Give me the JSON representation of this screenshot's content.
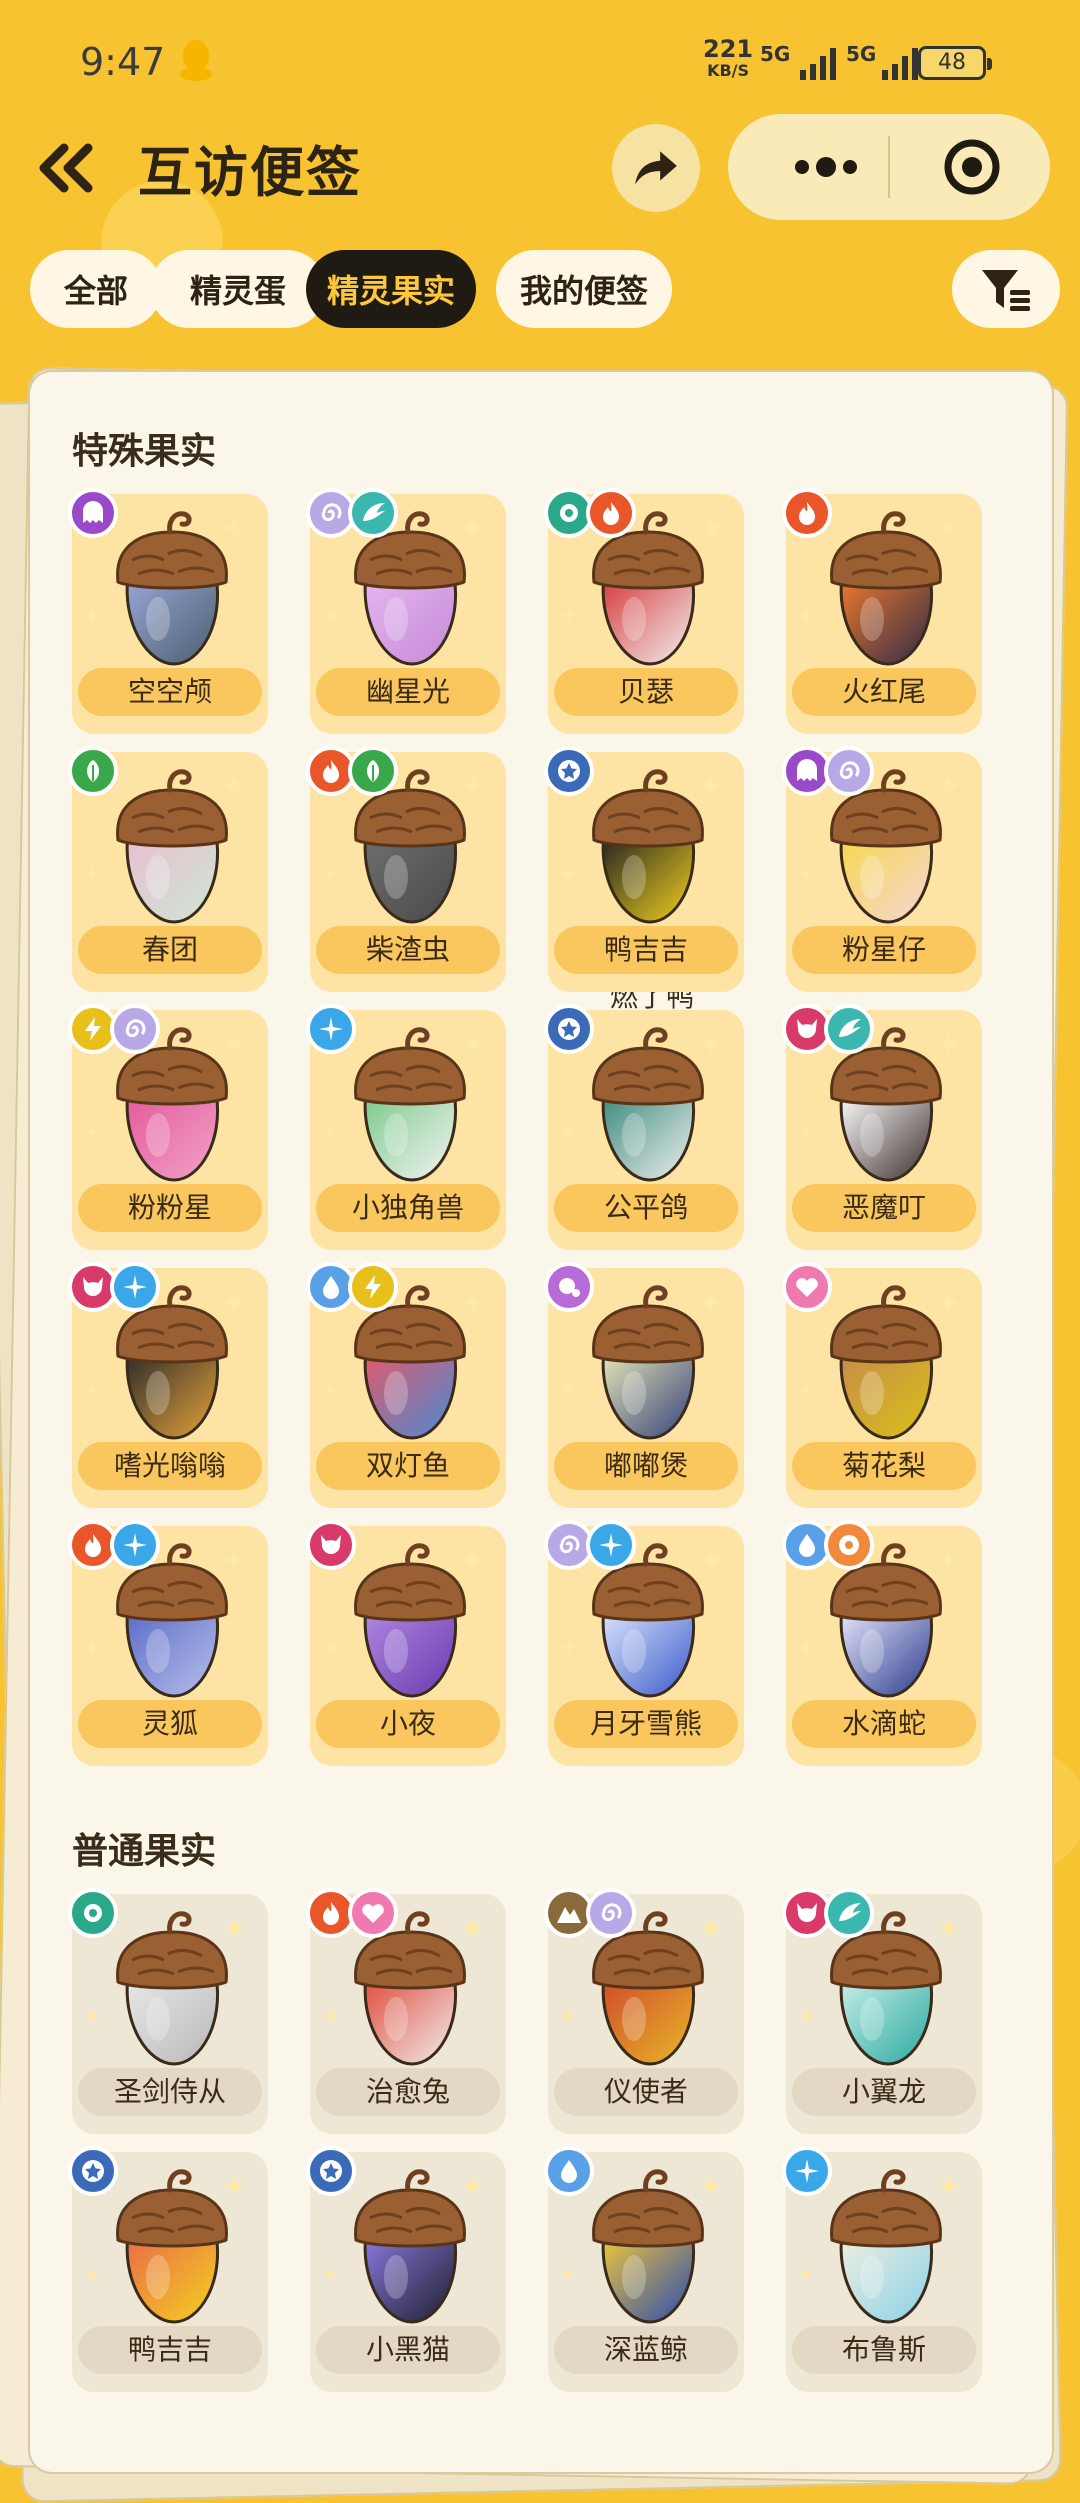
{
  "status_bar": {
    "time": "9:47",
    "net_speed": "221",
    "net_unit": "KB/S",
    "sig1": "5G",
    "sig2": "5G",
    "battery": "48"
  },
  "header": {
    "title": "互访便签"
  },
  "tabs": [
    {
      "label": "全部",
      "active": false
    },
    {
      "label": "精灵蛋",
      "active": false
    },
    {
      "label": "精灵果实",
      "active": true
    },
    {
      "label": "我的便签",
      "active": false
    }
  ],
  "sections": {
    "special": {
      "title": "特殊果实"
    },
    "normal": {
      "title": "普通果实"
    }
  },
  "special_items": [
    {
      "name": "空空颅",
      "badges": [
        "ghost-icon"
      ],
      "colors": [
        "#4a5f6e",
        "#9aa6d8"
      ]
    },
    {
      "name": "幽星光",
      "badges": [
        "spiral-icon",
        "wing-icon"
      ],
      "colors": [
        "#c48ad6",
        "#e6b6f0"
      ]
    },
    {
      "name": "贝瑟",
      "badges": [
        "gear-icon",
        "fire-icon"
      ],
      "colors": [
        "#f2f2f2",
        "#d63a3a"
      ]
    },
    {
      "name": "火红尾",
      "badges": [
        "fire-icon"
      ],
      "colors": [
        "#2e2a4a",
        "#f07a2a"
      ]
    },
    {
      "name": "春团",
      "badges": [
        "leaf-icon"
      ],
      "colors": [
        "#cfe6d4",
        "#e8bfd0"
      ]
    },
    {
      "name": "柴渣虫",
      "badges": [
        "fire-icon",
        "leaf-icon"
      ],
      "colors": [
        "#4a4a4a",
        "#6e6e6e"
      ]
    },
    {
      "name": "鸭吉吉",
      "badges": [
        "star-icon"
      ],
      "colors": [
        "#f5d21e",
        "#222222"
      ]
    },
    {
      "name": "粉星仔",
      "badges": [
        "ghost-icon",
        "spiral-icon"
      ],
      "colors": [
        "#f6d6d6",
        "#f5d84a"
      ]
    },
    {
      "name": "粉粉星",
      "badges": [
        "bolt-icon",
        "spiral-icon"
      ],
      "colors": [
        "#f2a2c8",
        "#e35a9a"
      ]
    },
    {
      "name": "小独角兽",
      "badges": [
        "sparkle-icon"
      ],
      "colors": [
        "#f4f4f4",
        "#7ac88a"
      ]
    },
    {
      "name": "公平鸽",
      "badges": [
        "star-icon"
      ],
      "colors": [
        "#f0f0f0",
        "#3a8a7a"
      ]
    },
    {
      "name": "恶魔叮",
      "badges": [
        "demon-icon",
        "wing-icon"
      ],
      "colors": [
        "#3a2e2a",
        "#ffffff"
      ]
    },
    {
      "name": "嗜光嗡嗡",
      "badges": [
        "demon-icon",
        "sparkle-icon"
      ],
      "colors": [
        "#e8a33a",
        "#2a2a2a"
      ]
    },
    {
      "name": "双灯鱼",
      "badges": [
        "water-icon",
        "bolt-icon"
      ],
      "colors": [
        "#4a8ad6",
        "#e35a6a"
      ]
    },
    {
      "name": "嘟嘟煲",
      "badges": [
        "bubble-icon"
      ],
      "colors": [
        "#34407a",
        "#e8e8b8"
      ]
    },
    {
      "name": "菊花梨",
      "badges": [
        "heart-icon"
      ],
      "colors": [
        "#d8c21a",
        "#c88a4a"
      ]
    },
    {
      "name": "灵狐",
      "badges": [
        "fire-icon",
        "sparkle-icon"
      ],
      "colors": [
        "#b8c0ea",
        "#5a6ac8"
      ]
    },
    {
      "name": "小夜",
      "badges": [
        "demon-icon"
      ],
      "colors": [
        "#6a3ab0",
        "#b088e0"
      ]
    },
    {
      "name": "月牙雪熊",
      "badges": [
        "spiral-icon",
        "sparkle-icon"
      ],
      "colors": [
        "#3a5ac8",
        "#dce6ff"
      ]
    },
    {
      "name": "水滴蛇",
      "badges": [
        "water-icon",
        "flower-icon"
      ],
      "colors": [
        "#2a3a8a",
        "#e8e8ff"
      ]
    }
  ],
  "nickname_note": "燃了鸭",
  "normal_items": [
    {
      "name": "圣剑侍从",
      "badges": [
        "gear-icon"
      ],
      "colors": [
        "#b8b8b8",
        "#e8e8e8"
      ]
    },
    {
      "name": "治愈兔",
      "badges": [
        "fire-icon",
        "heart-icon"
      ],
      "colors": [
        "#f0f0f0",
        "#e04a3a"
      ]
    },
    {
      "name": "仪使者",
      "badges": [
        "mountain-icon",
        "spiral-icon"
      ],
      "colors": [
        "#e8b82a",
        "#d04a2a"
      ]
    },
    {
      "name": "小翼龙",
      "badges": [
        "demon-icon",
        "wing-icon"
      ],
      "colors": [
        "#2aa8a0",
        "#c8f0e8"
      ]
    },
    {
      "name": "鸭吉吉",
      "badges": [
        "star-icon"
      ],
      "colors": [
        "#f5d21e",
        "#e86a4a"
      ]
    },
    {
      "name": "小黑猫",
      "badges": [
        "star-icon"
      ],
      "colors": [
        "#1e1e2a",
        "#8a7ae0"
      ]
    },
    {
      "name": "深蓝鲸",
      "badges": [
        "water-icon"
      ],
      "colors": [
        "#2a4ab0",
        "#f0c83a"
      ]
    },
    {
      "name": "布鲁斯",
      "badges": [
        "sparkle-icon"
      ],
      "colors": [
        "#8ad0e8",
        "#f0f0e0"
      ]
    }
  ],
  "badge_colors": {
    "ghost-icon": "#9a4ac8",
    "spiral-icon": "#b8a8e6",
    "wing-icon": "#3ab8b0",
    "gear-icon": "#2aa88a",
    "fire-icon": "#e8562a",
    "leaf-icon": "#3aa84a",
    "star-icon": "#3a6ab8",
    "bolt-icon": "#e8c01a",
    "sparkle-icon": "#3aa8e8",
    "demon-icon": "#d83a6a",
    "water-icon": "#5aa0e8",
    "bubble-icon": "#b86ad8",
    "heart-icon": "#f07ab0",
    "flower-icon": "#f08a3a",
    "mountain-icon": "#8a6a3a"
  }
}
